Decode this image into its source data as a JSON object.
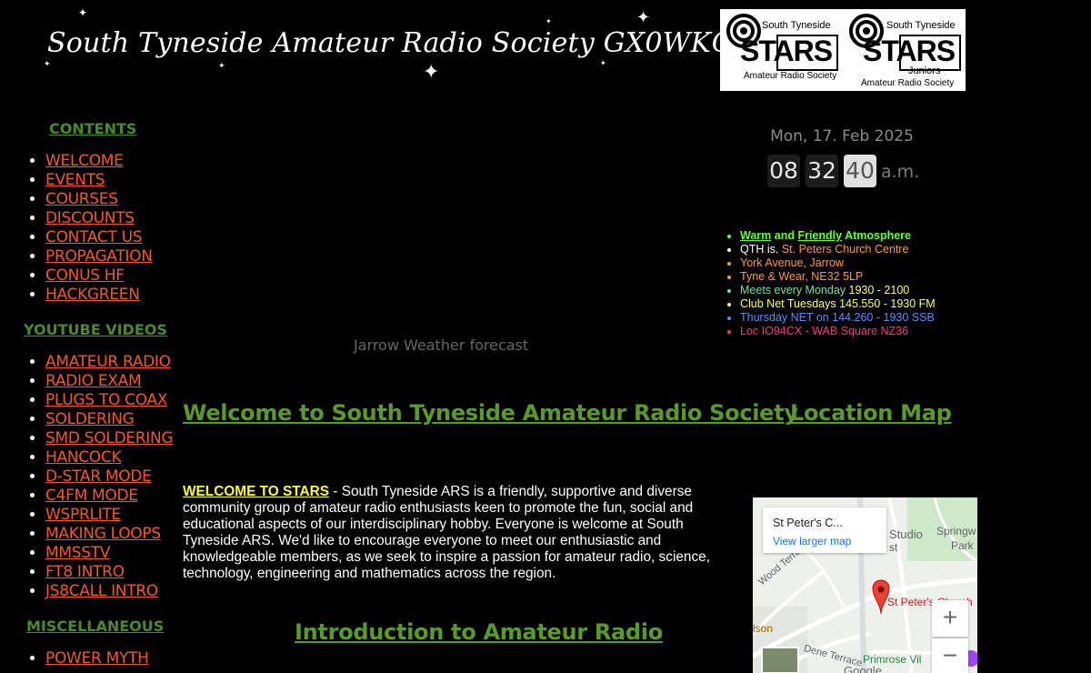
{
  "header": {
    "title": "South Tyneside Amateur Radio Society GX0WKQ"
  },
  "logos": [
    {
      "top_line": "South Tyneside",
      "big": "STARS",
      "sub": "",
      "bottom": "Amateur Radio Society"
    },
    {
      "top_line": "South Tyneside",
      "big": "STARS",
      "sub": "Juniors",
      "bottom": "Amateur Radio Society"
    }
  ],
  "sidebar": {
    "contents_heading": "CONTENTS",
    "contents": [
      "WELCOME",
      "EVENTS",
      "COURSES",
      "DISCOUNTS",
      "CONTACT US",
      "PROPAGATION",
      "CONUS HF",
      "HACKGREEN"
    ],
    "youtube_heading": "YOUTUBE VIDEOS",
    "youtube": [
      "AMATEUR RADIO",
      "RADIO EXAM",
      "PLUGS TO COAX",
      "SOLDERING",
      "SMD SOLDERING",
      "HANCOCK",
      "D-STAR MODE",
      "C4FM MODE",
      "WSPRLITE",
      "MAKING LOOPS",
      "MMSSTV",
      "FT8 INTRO",
      "JS8CALL INTRO"
    ],
    "misc_heading": "MISCELLANEOUS",
    "misc": [
      "POWER MYTH"
    ]
  },
  "clock": {
    "date": "Mon, 17. Feb 2025",
    "hours": "08",
    "minutes": "32",
    "seconds": "40",
    "ampm": "a.m."
  },
  "info": {
    "warm": "Warm",
    "and1": " and ",
    "friendly": "Friendly",
    "atmosphere": " Atmosphere",
    "qth_label": "QTH is. ",
    "qth_value": "St. Peters Church Centre",
    "line3": "York Avenue, Jarrow",
    "line4": "Tyne & Wear, NE32 5LP",
    "meets_label": "Meets every Monday ",
    "meets_time": "1930 - 2100",
    "clubnet": "Club Net Tuesdays 145.550 - 1930 FM",
    "thursday": "Thursday NET on 144.260 - 1930 SSB",
    "loc": "Loc IO94CX - WAB Square NZ36",
    "colors": {
      "green": "#66ff33",
      "white": "#ffffff",
      "orange": "#ff9933",
      "teal": "#66e6a8",
      "yellow": "#ffff66",
      "blue": "#5a8cff",
      "pink": "#ff3388"
    }
  },
  "weather": {
    "label": "Jarrow Weather forecast"
  },
  "main": {
    "welcome_heading": "Welcome to South Tyneside Amateur Radio Society",
    "location_heading": "Location Map",
    "welcome_lead": "WELCOME TO STARS",
    "welcome_body": " - South Tyneside ARS is a friendly, supportive and diverse community group of amateur radio enthusiasts keen to promote the fun, social and educational aspects of our interdisciplinary hobby. Everyone is welcome at South Tyneside ARS. We'd like to encourage everyone to meet our enthusiastic and knowledgeable members, as we seek to inspire a passion for amateur radio, science, technology, engineering and mathematics across the region.",
    "intro_heading": "Introduction to Amateur Radio"
  },
  "map": {
    "card_title": "St Peter's C...",
    "card_link": "View larger map",
    "labels": {
      "studio": "Studio",
      "st": "st",
      "springwell": "Springw",
      "park": "Park",
      "wood_terrace": "Wood Terrace",
      "st_peters": "St Peter's Church",
      "olson": "lson",
      "dene_terrace": "Dene Terrace",
      "primrose": "Primrose Vil",
      "google": "Google"
    },
    "zoom_in": "+",
    "zoom_out": "−"
  }
}
